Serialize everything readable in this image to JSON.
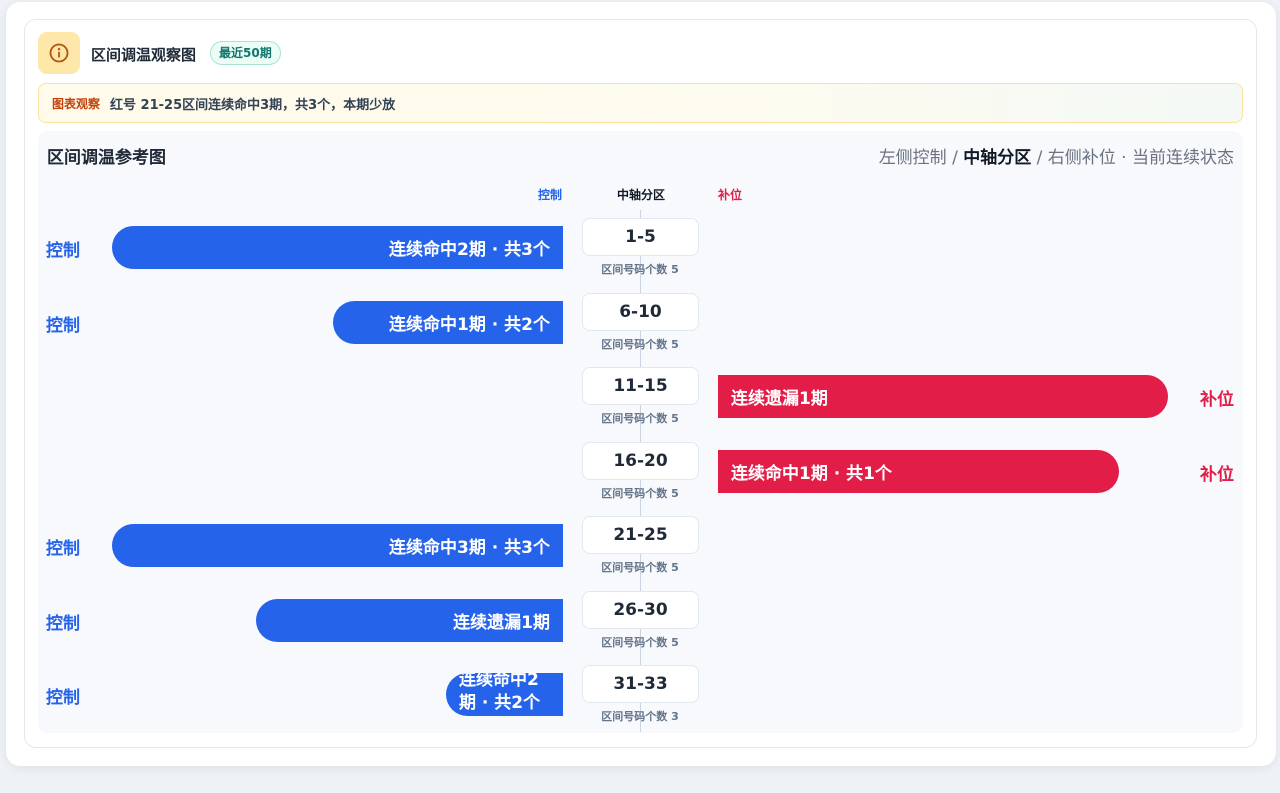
{
  "header": {
    "title": "区间调温观察图",
    "badge": "最近50期",
    "info_icon": "info-circle-icon"
  },
  "notice": {
    "tag": "图表观察",
    "text": "红号 21-25区间连续命中3期，共3个，本期少放"
  },
  "chart": {
    "title": "区间调温参考图",
    "legend": {
      "left": "左侧控制",
      "sep1": " / ",
      "center": "中轴分区",
      "sep2": " / ",
      "right": "右侧补位",
      "dot": " · ",
      "state": "当前连续状态"
    },
    "columns": {
      "control": "控制",
      "axis": "中轴分区",
      "fill": "补位"
    }
  },
  "chart_data": {
    "type": "bar",
    "orientation": "diverging-horizontal",
    "categories": [
      "1-5",
      "6-10",
      "11-15",
      "16-20",
      "21-25",
      "26-30",
      "31-33"
    ],
    "zone_counts": [
      "区间号码个数 5",
      "区间号码个数 5",
      "区间号码个数 5",
      "区间号码个数 5",
      "区间号码个数 5",
      "区间号码个数 5",
      "区间号码个数 3"
    ],
    "rows": [
      {
        "zone": "1-5",
        "side": "控制",
        "label": "连续命中2期 · 共3个",
        "length": 1.0
      },
      {
        "zone": "6-10",
        "side": "控制",
        "label": "连续命中1期 · 共2个",
        "length": 0.51
      },
      {
        "zone": "11-15",
        "side": "补位",
        "label": "连续遗漏1期",
        "length": 1.0
      },
      {
        "zone": "16-20",
        "side": "补位",
        "label": "连续命中1期 · 共1个",
        "length": 0.89
      },
      {
        "zone": "21-25",
        "side": "控制",
        "label": "连续命中3期 · 共3个",
        "length": 1.0
      },
      {
        "zone": "26-30",
        "side": "控制",
        "label": "连续遗漏1期",
        "length": 0.68
      },
      {
        "zone": "31-33",
        "side": "控制",
        "label": "连续命中2期 · 共2个",
        "length": 0.26
      }
    ],
    "colors": {
      "control": "#2563eb",
      "fill": "#e11d48"
    }
  }
}
